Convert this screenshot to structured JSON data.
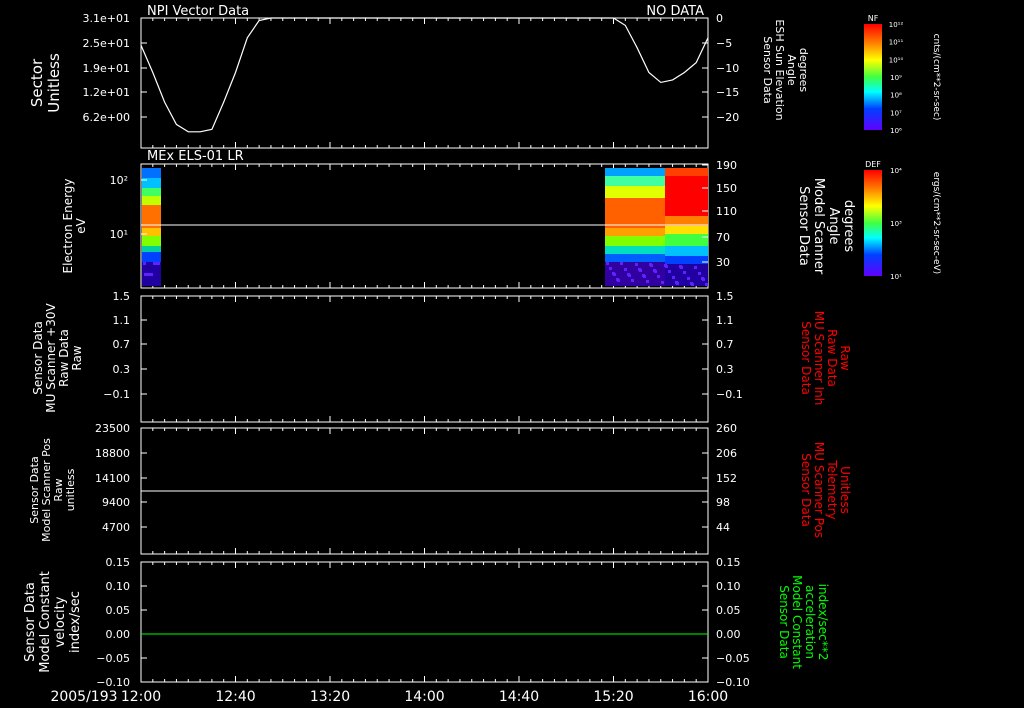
{
  "date_label": "2005/193",
  "x_ticks": [
    "12:00",
    "12:40",
    "13:20",
    "14:00",
    "14:40",
    "15:20",
    "16:00"
  ],
  "chart_data": [
    {
      "type": "line",
      "title": "NPI Vector Data",
      "status": "NO DATA",
      "ylabel_lines": [
        "Sector",
        "Unitless"
      ],
      "y_ticks": [
        "3.1e+01",
        "2.5e+01",
        "1.9e+01",
        "1.2e+01",
        "6.2e+00"
      ],
      "y2label_lines": [
        "Sensor Data",
        "ESH Sun Elevation",
        "Angle",
        "degrees"
      ],
      "y2_ticks": [
        "0",
        "−5",
        "−10",
        "−15",
        "−20"
      ],
      "y2lim": [
        -25,
        0
      ],
      "series": [
        {
          "color": "#ffffff",
          "x": [
            "12:00",
            "12:05",
            "12:10",
            "12:15",
            "12:20",
            "12:25",
            "12:30",
            "12:35",
            "12:40",
            "12:45",
            "12:50",
            "12:55",
            "15:20",
            "15:25",
            "15:30",
            "15:35",
            "15:40",
            "15:45",
            "15:50",
            "15:55",
            "16:00"
          ],
          "y": [
            -5.5,
            -11,
            -17,
            -21.5,
            -23,
            -23,
            -22.5,
            -17,
            -11,
            -4,
            -0.5,
            0,
            0,
            -1.5,
            -6,
            -11,
            -13,
            -12.5,
            -11,
            -9,
            -4
          ]
        }
      ]
    },
    {
      "type": "heatmap",
      "title": "MEx ELS-01 LR",
      "ylabel_lines": [
        "Electron Energy",
        "eV"
      ],
      "y_ticks": [
        "10²",
        "10¹"
      ],
      "y2label_lines": [
        "Sensor Data",
        "Model Scanner",
        "Angle",
        "degrees"
      ],
      "y2_ticks": [
        "190",
        "150",
        "110",
        "70",
        "30"
      ],
      "y2lim": [
        0,
        190
      ],
      "colorbar": {
        "label": "DEF",
        "units": "ergs/(cm**2-sr-sec-eV)",
        "ticks": [
          "10⁴",
          "10³",
          "10¹"
        ]
      },
      "data_intervals": [
        [
          "12:00",
          "12:04"
        ],
        [
          "15:14",
          "16:00"
        ]
      ],
      "overlay_line": {
        "color": "#ffffff",
        "value_eV": 14
      }
    },
    {
      "type": "line",
      "ylabel_lines": [
        "Sensor Data",
        "MU Scanner +30V",
        "Raw Data",
        "Raw"
      ],
      "y_ticks": [
        "1.5",
        "1.1",
        "0.7",
        "0.3",
        "−0.1"
      ],
      "y2label_lines": [
        "Sensor Data",
        "MU Scanner Inh",
        "Raw Data",
        "Raw"
      ],
      "y2_ticks": [
        "1.5",
        "1.1",
        "0.7",
        "0.3",
        "−0.1"
      ],
      "y2label_color": "#ff0000",
      "series": []
    },
    {
      "type": "line",
      "ylabel_lines": [
        "Sensor Data",
        "Model Scanner Pos",
        "Raw",
        "unitless"
      ],
      "y_ticks": [
        "23500",
        "18800",
        "14100",
        "9400",
        "4700"
      ],
      "ylim": [
        0,
        23500
      ],
      "y2label_lines": [
        "Sensor Data",
        "MU Scanner Pos",
        "Telemetry",
        "Unitless"
      ],
      "y2_ticks": [
        "260",
        "206",
        "152",
        "98",
        "44"
      ],
      "y2label_color": "#ff0000",
      "series": [
        {
          "color": "#ffffff",
          "x": [
            "12:00",
            "16:00"
          ],
          "y": [
            11100,
            11100
          ]
        }
      ]
    },
    {
      "type": "line",
      "ylabel_lines": [
        "Sensor Data",
        "Model Constant",
        "velocity",
        "index/sec"
      ],
      "y_ticks": [
        "0.15",
        "0.10",
        "0.05",
        "0.00",
        "−0.05",
        "−0.10"
      ],
      "ylim": [
        -0.1,
        0.15
      ],
      "y2label_lines": [
        "Sensor Data",
        "Model Constant",
        "acceleration",
        "index/sec**2"
      ],
      "y2_ticks": [
        "0.15",
        "0.10",
        "0.05",
        "0.00",
        "−0.05",
        "−0.10"
      ],
      "y2label_color": "#00ff00",
      "series": [
        {
          "color": "#00ff00",
          "x": [
            "12:00",
            "16:00"
          ],
          "y": [
            0,
            0
          ]
        }
      ]
    }
  ],
  "top_colorbar": {
    "label": "NF",
    "units": "cnts/(cm**2-sr-sec)",
    "ticks": [
      "10¹²",
      "10¹¹",
      "10¹⁰",
      "10⁹",
      "10⁸",
      "10⁷",
      "10⁶"
    ]
  }
}
